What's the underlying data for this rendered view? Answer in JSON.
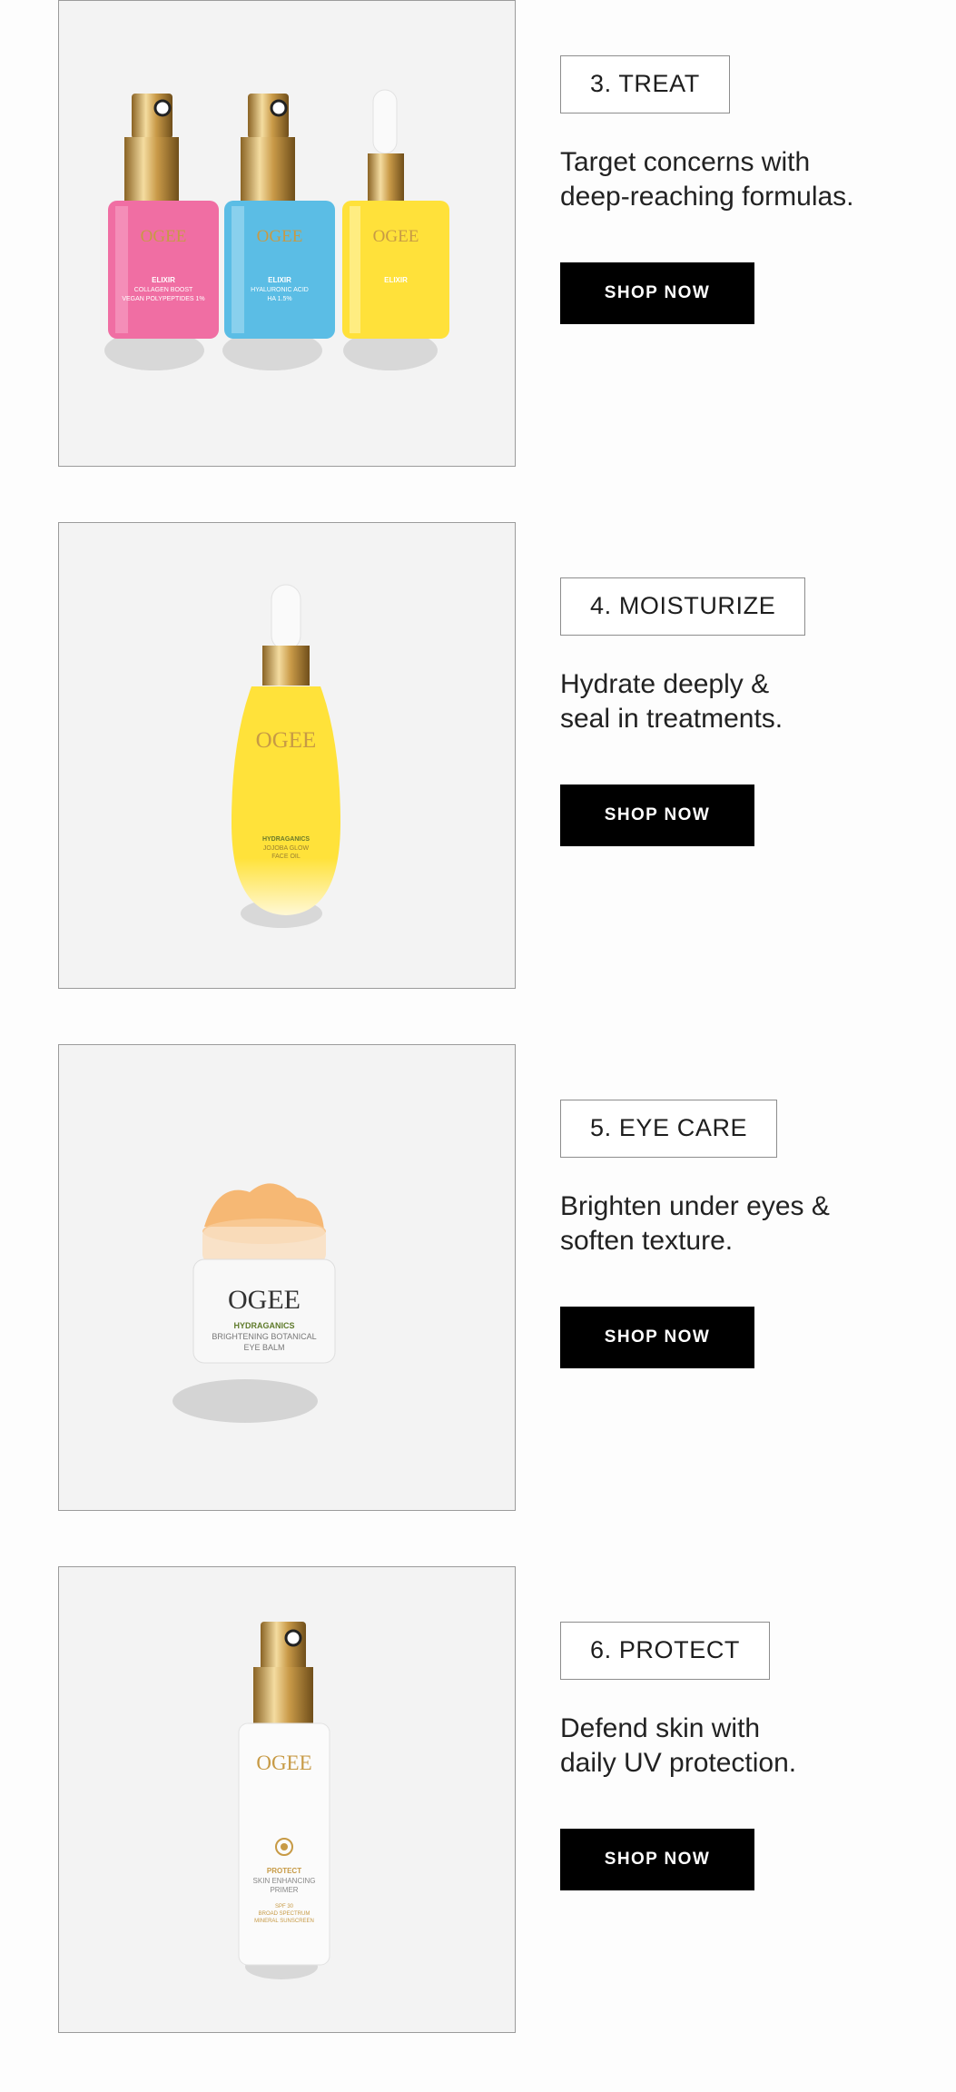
{
  "sections": [
    {
      "step": "3. TREAT",
      "desc_line1": "Target concerns with",
      "desc_line2": "deep-reaching formulas.",
      "cta": "SHOP NOW",
      "products": [
        {
          "brand": "OGEE",
          "line": "ELIXIR",
          "name": "COLLAGEN BOOST",
          "sub": "VEGAN POLYPEPTIDES 1%",
          "color": "#f06ea3"
        },
        {
          "brand": "OGEE",
          "line": "ELIXIR",
          "name": "HYALURONIC ACID",
          "sub": "HA 1.5%",
          "color": "#5bbde5"
        },
        {
          "brand": "OGEE",
          "line": "ELIXIR",
          "name": "",
          "sub": "",
          "color": "#ffe13a"
        }
      ]
    },
    {
      "step": "4. MOISTURIZE",
      "desc_line1": "Hydrate deeply &",
      "desc_line2": "seal in treatments.",
      "cta": "SHOP NOW",
      "product": {
        "brand": "OGEE",
        "line": "HYDRAGANICS",
        "name": "JOJOBA GLOW",
        "sub": "FACE OIL",
        "color": "#ffe23a"
      }
    },
    {
      "step": "5. EYE CARE",
      "desc_line1": "Brighten under eyes &",
      "desc_line2": "soften texture.",
      "cta": "SHOP NOW",
      "product": {
        "brand": "OGEE",
        "line": "HYDRAGANICS",
        "name": "BRIGHTENING BOTANICAL",
        "sub": "EYE BALM",
        "color": "#f6b874"
      }
    },
    {
      "step": "6. PROTECT",
      "desc_line1": "Defend skin with",
      "desc_line2": "daily UV protection.",
      "cta": "SHOP NOW",
      "product": {
        "brand": "OGEE",
        "line": "PROTECT",
        "name": "SKIN ENHANCING",
        "sub": "PRIMER",
        "extra1": "SPF 30",
        "extra2": "BROAD SPECTRUM",
        "extra3": "MINERAL SUNSCREEN",
        "color": "#ffffff"
      }
    }
  ],
  "colors": {
    "photo_bg": "#f3f3f3",
    "button_bg": "#000000",
    "button_text": "#ffffff",
    "gold": "#c79a45"
  }
}
